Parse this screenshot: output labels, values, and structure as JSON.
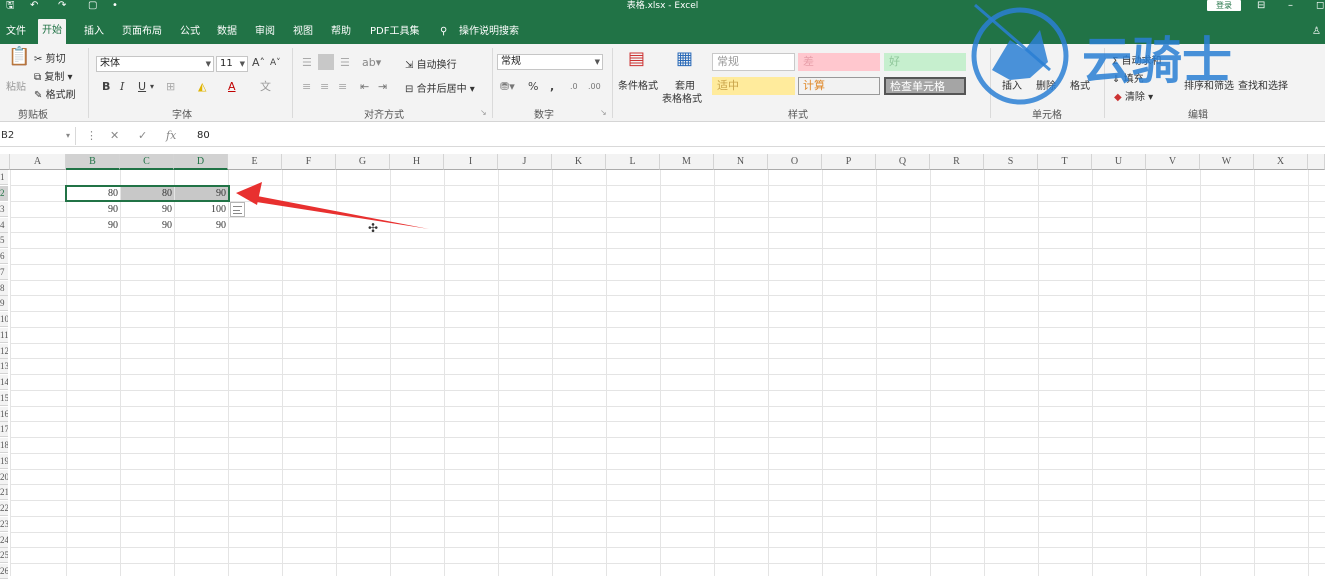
{
  "window": {
    "title": "表格.xlsx  -  Excel",
    "login_label": "登录"
  },
  "tabs": [
    "文件",
    "开始",
    "插入",
    "页面布局",
    "公式",
    "数据",
    "审阅",
    "视图",
    "帮助",
    "PDF工具集",
    "操作说明搜索"
  ],
  "ribbon": {
    "clipboard": {
      "paste": "粘贴",
      "cut": "剪切",
      "copy": "复制",
      "format_painter": "格式刷",
      "group": "剪贴板"
    },
    "font": {
      "name": "宋体",
      "size": "11",
      "group": "字体"
    },
    "alignment": {
      "wrap": "自动换行",
      "merge": "合并后居中",
      "group": "对齐方式"
    },
    "number": {
      "format": "常规",
      "group": "数字"
    },
    "styles": {
      "conditional": "条件格式",
      "table_format_1": "套用",
      "table_format_2": "表格格式",
      "normal": "常规",
      "bad": "差",
      "good": "好",
      "neutral": "适中",
      "calc": "计算",
      "check": "检查单元格",
      "group": "样式"
    },
    "cells": {
      "insert": "插入",
      "delete": "删除",
      "format": "格式",
      "group": "单元格"
    },
    "editing": {
      "autosum": "自动求和",
      "fill": "填充",
      "clear": "清除",
      "sort": "排序和筛选",
      "find": "查找和选择",
      "group": "编辑"
    }
  },
  "formula_bar": {
    "name_box": "B2",
    "value": "80",
    "fx": "fx"
  },
  "columns": [
    "A",
    "B",
    "C",
    "D",
    "E",
    "F",
    "G",
    "H",
    "I",
    "J",
    "K",
    "L",
    "M",
    "N",
    "O",
    "P",
    "Q",
    "R",
    "S",
    "T",
    "U",
    "V",
    "W",
    "X"
  ],
  "rows": [
    "1",
    "2",
    "3",
    "4",
    "5",
    "6",
    "7",
    "8",
    "9",
    "10",
    "11",
    "12",
    "13",
    "14",
    "15",
    "16",
    "17",
    "18",
    "19",
    "20",
    "21",
    "22",
    "23",
    "24",
    "25",
    "26"
  ],
  "cells": [
    {
      "ref": "B2",
      "value": "80"
    },
    {
      "ref": "C2",
      "value": "80"
    },
    {
      "ref": "D2",
      "value": "90"
    },
    {
      "ref": "B3",
      "value": "90"
    },
    {
      "ref": "C3",
      "value": "90"
    },
    {
      "ref": "D3",
      "value": "100"
    },
    {
      "ref": "B4",
      "value": "90"
    },
    {
      "ref": "C4",
      "value": "90"
    },
    {
      "ref": "D4",
      "value": "90"
    }
  ],
  "watermark": {
    "text": "云骑士"
  },
  "colors": {
    "excel_green": "#217346",
    "arrow_red": "#e8302f",
    "watermark_blue": "#2a7fd4"
  }
}
